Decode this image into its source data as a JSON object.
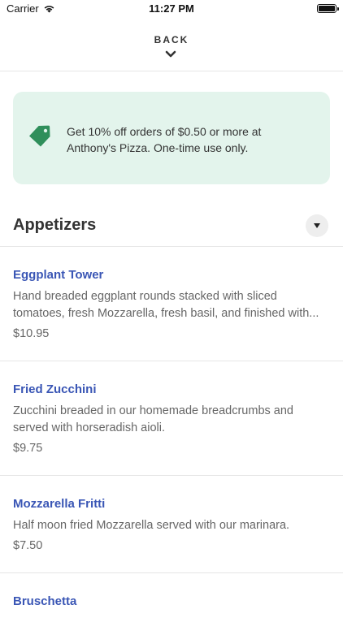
{
  "status_bar": {
    "carrier": "Carrier",
    "time": "11:27 PM"
  },
  "header": {
    "back_label": "BACK"
  },
  "promo": {
    "text": "Get 10% off orders of $0.50 or more at Anthony's Pizza. One-time use only.",
    "accent": "#2f8f5b"
  },
  "section": {
    "title": "Appetizers"
  },
  "menu_items": [
    {
      "name": "Eggplant Tower",
      "description_lines": [
        "Hand breaded eggplant rounds stacked with sliced",
        "tomatoes, fresh Mozzarella, fresh basil, and finished with..."
      ],
      "price": "$10.95"
    },
    {
      "name": "Fried Zucchini",
      "description_lines": [
        "Zucchini breaded in our homemade breadcrumbs and",
        "served with horseradish aioli."
      ],
      "price": "$9.75"
    },
    {
      "name": "Mozzarella Fritti",
      "description_lines": [
        "Half moon fried Mozzarella served with our marinara."
      ],
      "price": "$7.50"
    },
    {
      "name": "Bruschetta",
      "description_lines": [],
      "price": ""
    }
  ],
  "colors": {
    "item_title": "#3a56b5",
    "promo_bg": "#e3f4ec"
  },
  "icons": {
    "tag": "tag-icon",
    "back": "chevron-down-icon",
    "collapse": "caret-down-icon"
  }
}
